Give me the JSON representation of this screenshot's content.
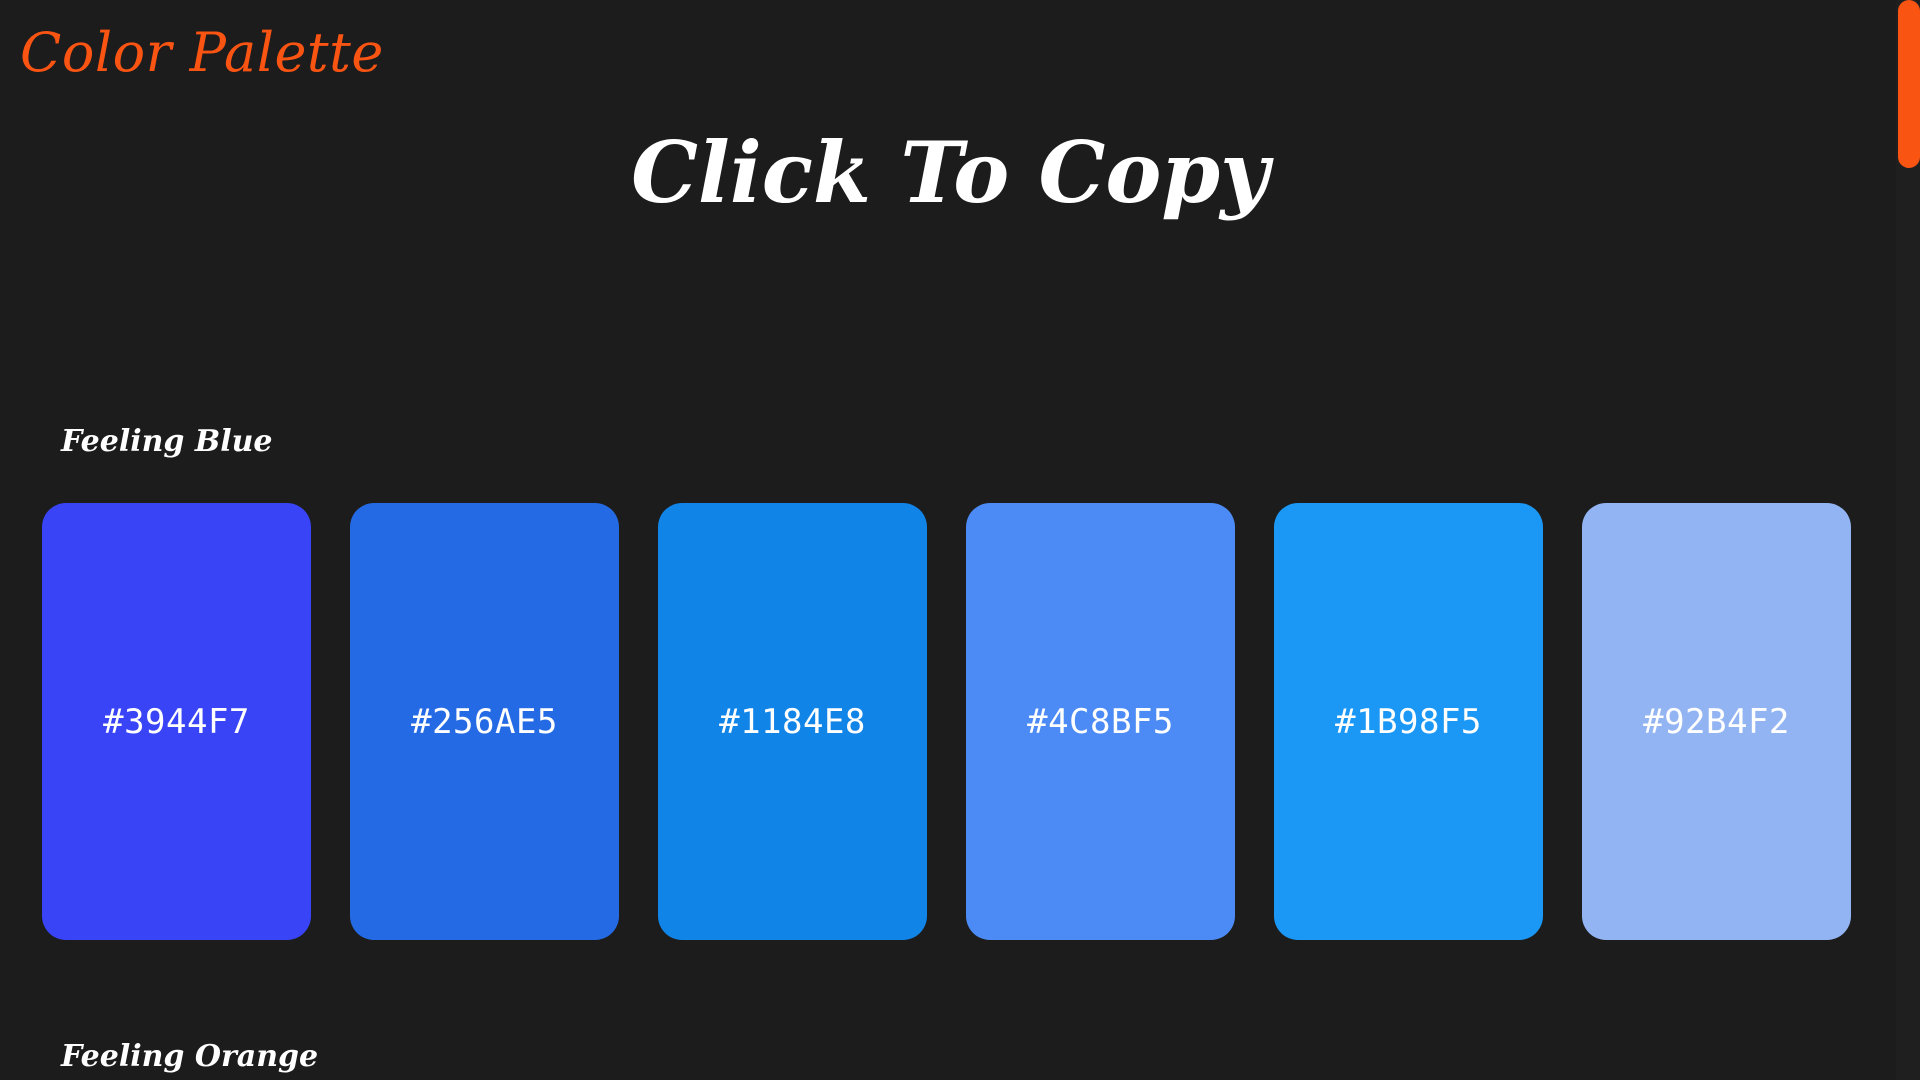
{
  "header": {
    "brand": "Color Palette",
    "hero_title": "Click To Copy"
  },
  "sections": [
    {
      "title": "Feeling Blue",
      "swatches": [
        {
          "label": "#3944F7",
          "color": "#3944F7"
        },
        {
          "label": "#256AE5",
          "color": "#256AE5"
        },
        {
          "label": "#1184E8",
          "color": "#1184E8"
        },
        {
          "label": "#4C8BF5",
          "color": "#4C8BF5"
        },
        {
          "label": "#1B98F5",
          "color": "#1B98F5"
        },
        {
          "label": "#92B4F2",
          "color": "#92B4F2"
        }
      ]
    },
    {
      "title": "Feeling Orange"
    }
  ],
  "theme": {
    "background": "#1c1c1c",
    "accent": "#fa5413",
    "text": "#ffffff"
  }
}
